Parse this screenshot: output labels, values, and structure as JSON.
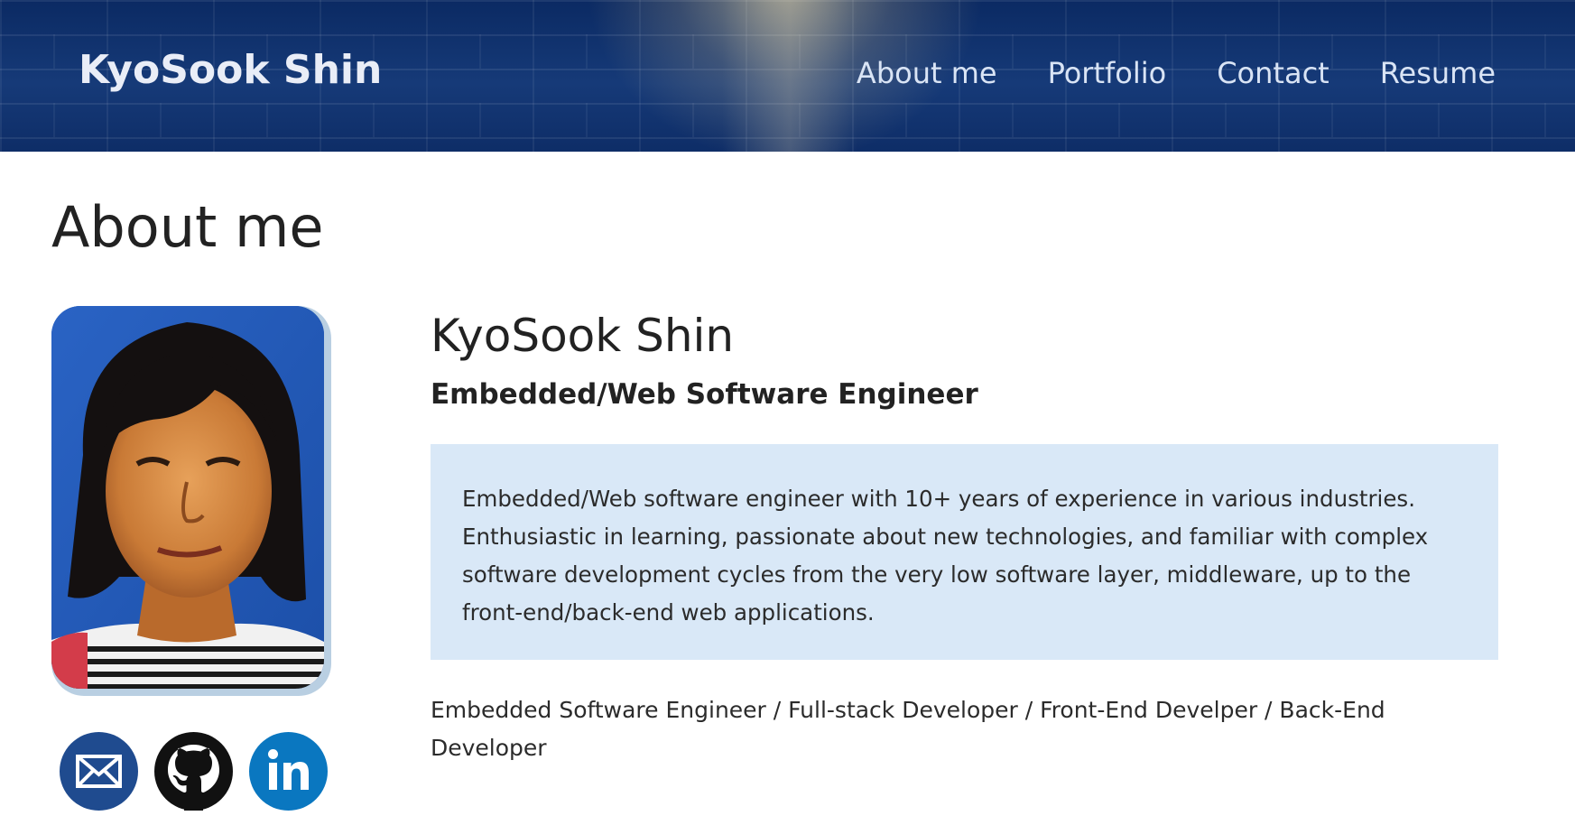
{
  "header": {
    "brand": "KyoSook Shin",
    "nav": [
      {
        "label": "About me"
      },
      {
        "label": "Portfolio"
      },
      {
        "label": "Contact"
      },
      {
        "label": "Resume"
      }
    ]
  },
  "main": {
    "page_title": "About me",
    "profile": {
      "photo_icon": "profile-photo",
      "name": "KyoSook Shin",
      "role": "Embedded/Web Software Engineer",
      "summary": "Embedded/Web software engineer with 10+ years of experience in various industries. Enthusiastic in learning, passionate about new technologies, and familiar with complex software development cycles from the very low software layer, middleware, up to the front-end/back-end web applications.",
      "titles": "Embedded Software Engineer / Full-stack Developer / Front-End Develper / Back-End Developer"
    },
    "social": [
      {
        "icon": "email-icon",
        "color": "#1f4b8f"
      },
      {
        "icon": "github-icon",
        "color": "#111111"
      },
      {
        "icon": "linkedin-icon",
        "color": "#0a77c0"
      }
    ]
  },
  "colors": {
    "header_bg": "#0b2a63",
    "summary_bg": "#d9e8f7",
    "photo_border": "#b9cfe2"
  }
}
